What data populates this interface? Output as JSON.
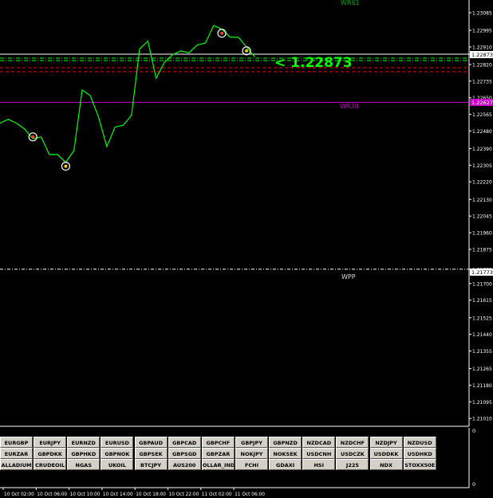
{
  "colors": {
    "background": "#000000",
    "price_line": "#00ff00",
    "current_price_label": "#00ff00",
    "wr38_line": "#cc00cc",
    "wpp_line": "#ffffff",
    "red_dashed": "#ff0000",
    "green_dashed": "#00ff00",
    "axis": "#ffffff"
  },
  "levels": {
    "top_label": "WR61",
    "wr38_label": "WR38",
    "wpp_label": "WPP",
    "current_price_text": "< 1.22873"
  },
  "price_axis": {
    "labels": [
      "1.23085",
      "1.22995",
      "1.22910",
      "1.22873",
      "1.22820",
      "1.22735",
      "1.22650",
      "1.22565",
      "1.22480",
      "1.22390",
      "1.22305",
      "1.22220",
      "1.22130",
      "1.22045",
      "1.21960",
      "1.21875",
      "1.21773",
      "1.21700",
      "1.21615",
      "1.21525",
      "1.21440",
      "1.21355",
      "1.21265",
      "1.21180",
      "1.21095",
      "1.21010"
    ],
    "current_box": "1.22873",
    "wr38_box": "1.22627",
    "wpp_box": "1.21773"
  },
  "sub_window": {
    "axis_top": "0",
    "axis_bottom": "0"
  },
  "time_axis": {
    "labels": [
      "10 Oct 02:00",
      "10 Oct 06:00",
      "10 Oct 10:00",
      "10 Oct 14:00",
      "10 Oct 18:00",
      "10 Oct 22:00",
      "11 Oct 02:00",
      "11 Oct 06:00"
    ]
  },
  "symbols": [
    [
      "EURGBP",
      "EURJPY",
      "EURNZD",
      "EURUSD",
      "GBPAUD",
      "GBPCAD",
      "GBPCHF",
      "GBPJPY",
      "GBPNZD",
      "NZDCAD",
      "NZDCHF",
      "NZDJPY",
      "NZDUSD"
    ],
    [
      "EURZAR",
      "GBPDKK",
      "GBPHKD",
      "GBPNOK",
      "GBPSEK",
      "GBPSGD",
      "GBPZAR",
      "NOKJPY",
      "NOKSEK",
      "USDCNH",
      "USDCZK",
      "USDDKK",
      "USDHKD"
    ],
    [
      "ALLADIUM",
      "CRUDEOIL",
      "NGAS",
      "UKOIL",
      "BTCJPY",
      "AUS200",
      "OLLAR_IND>",
      "FCHI",
      "GDAXI",
      "HSI",
      "J225",
      "NDX",
      "STOXX50E"
    ]
  ],
  "chart_data": {
    "type": "line",
    "x": [
      "10 Oct 00:00",
      "10 Oct 01:00",
      "10 Oct 02:00",
      "10 Oct 03:00",
      "10 Oct 04:00",
      "10 Oct 05:00",
      "10 Oct 06:00",
      "10 Oct 07:00",
      "10 Oct 08:00",
      "10 Oct 09:00",
      "10 Oct 10:00",
      "10 Oct 11:00",
      "10 Oct 12:00",
      "10 Oct 13:00",
      "10 Oct 14:00",
      "10 Oct 15:00",
      "10 Oct 16:00",
      "10 Oct 17:00",
      "10 Oct 18:00",
      "10 Oct 19:00",
      "10 Oct 20:00",
      "10 Oct 21:00",
      "10 Oct 22:00",
      "10 Oct 23:00",
      "11 Oct 00:00",
      "11 Oct 01:00",
      "11 Oct 02:00",
      "11 Oct 03:00",
      "11 Oct 04:00",
      "11 Oct 05:00",
      "11 Oct 06:00",
      "11 Oct 07:00"
    ],
    "values": [
      1.2252,
      1.2254,
      1.2252,
      1.2249,
      1.2244,
      1.2245,
      1.2236,
      1.2236,
      1.2232,
      1.2238,
      1.2269,
      1.2266,
      1.2255,
      1.224,
      1.225,
      1.2251,
      1.2256,
      1.229,
      1.2294,
      1.2275,
      1.2283,
      1.2287,
      1.2289,
      1.2288,
      1.2292,
      1.2293,
      1.2302,
      1.23,
      1.2296,
      1.2296,
      1.2291,
      1.2286
    ],
    "ylim": [
      1.2097,
      1.2315
    ],
    "arrow_markers": [
      {
        "x": "10 Oct 04:00",
        "y": 1.2245
      },
      {
        "x": "10 Oct 08:00",
        "y": 1.223
      },
      {
        "x": "11 Oct 03:00",
        "y": 1.2298
      },
      {
        "x": "11 Oct 06:00",
        "y": 1.2289
      }
    ],
    "horizontal_levels": [
      {
        "name": "WR61",
        "y": 1.2316
      },
      {
        "name": "WR38",
        "y": 1.22627
      },
      {
        "name": "WPP",
        "y": 1.21773
      },
      {
        "name": "current",
        "y": 1.22873
      }
    ],
    "grid": false
  }
}
